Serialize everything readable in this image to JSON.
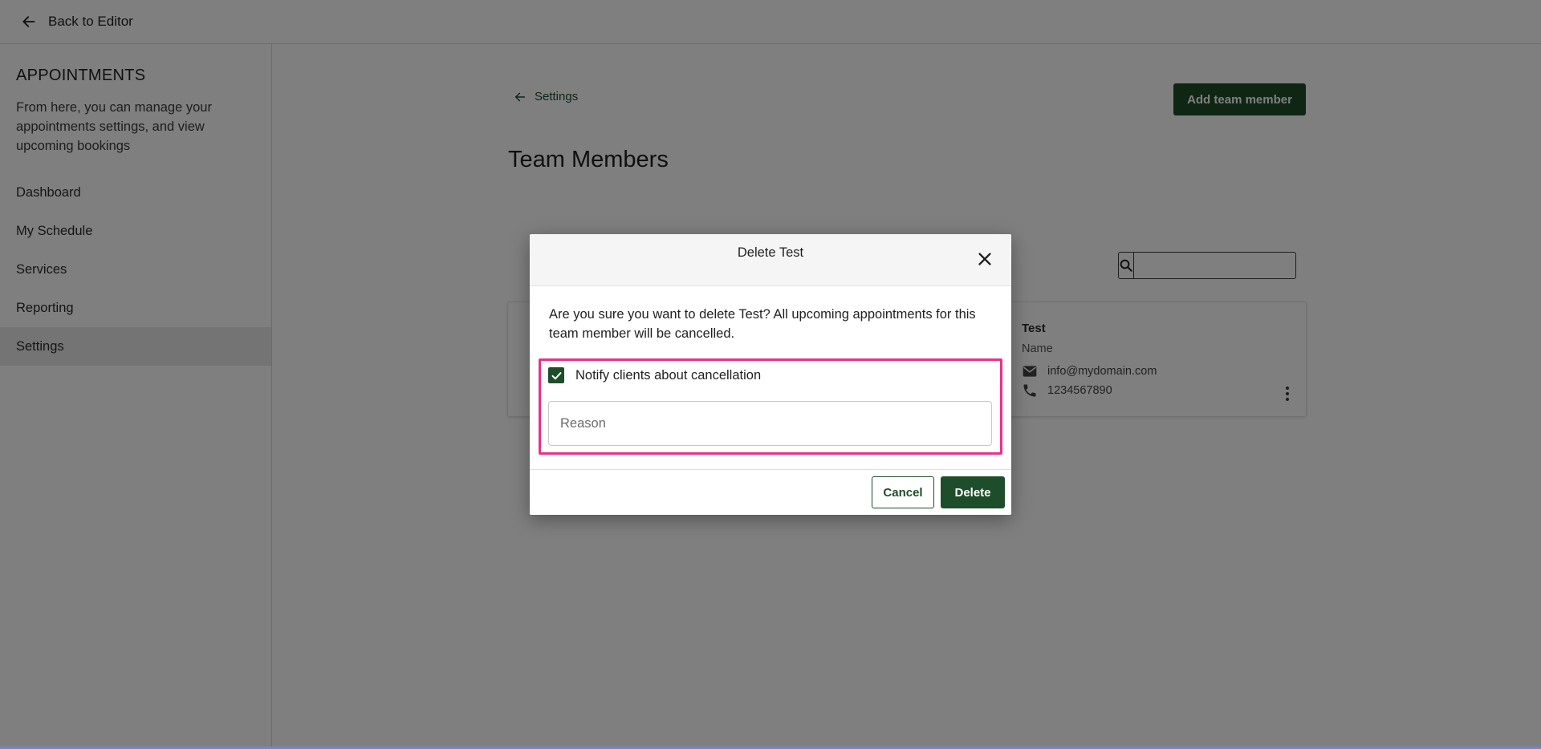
{
  "topbar": {
    "back_label": "Back to Editor"
  },
  "sidebar": {
    "title": "APPOINTMENTS",
    "description": "From here, you can manage your appointments settings, and view upcoming bookings",
    "items": [
      {
        "label": "Dashboard",
        "active": false
      },
      {
        "label": "My Schedule",
        "active": false
      },
      {
        "label": "Services",
        "active": false
      },
      {
        "label": "Reporting",
        "active": false
      },
      {
        "label": "Settings",
        "active": true
      }
    ]
  },
  "main": {
    "back_link_label": "Settings",
    "add_button_label": "Add team member",
    "page_title": "Team Members",
    "search": {
      "value": "",
      "placeholder": ""
    },
    "member": {
      "name": "Test",
      "role": "Name",
      "email": "info@mydomain.com",
      "phone": "1234567890"
    }
  },
  "dialog": {
    "title": "Delete Test",
    "message": "Are you sure you want to delete Test? All upcoming appointments for this team member will be cancelled.",
    "notify_label": "Notify clients about cancellation",
    "notify_checked": true,
    "reason_placeholder": "Reason",
    "reason_value": "",
    "cancel_label": "Cancel",
    "delete_label": "Delete"
  },
  "colors": {
    "brand_green": "#1e4d2b",
    "highlight_pink": "#e6338a",
    "overlay": "rgba(0,0,0,0.5)"
  },
  "icons": {
    "back": "arrow-left-icon",
    "search": "search-icon",
    "email": "mail-icon",
    "phone": "phone-icon",
    "menu": "kebab-icon",
    "close": "close-icon",
    "check": "check-icon"
  }
}
